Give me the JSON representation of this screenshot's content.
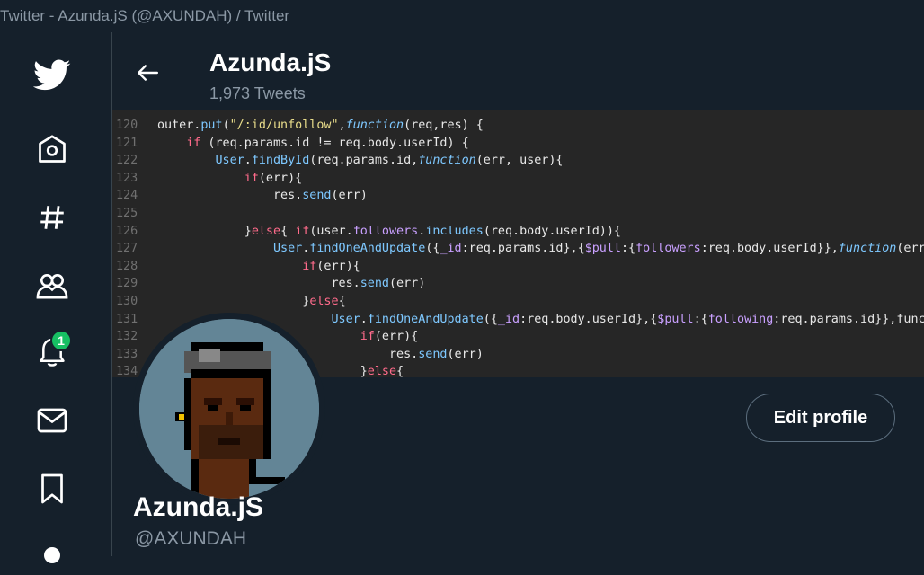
{
  "window": {
    "title": "Twitter - Azunda.jS (@AXUNDAH) / Twitter"
  },
  "sidebar": {
    "items": [
      {
        "name": "twitter-logo-icon"
      },
      {
        "name": "home-icon"
      },
      {
        "name": "explore-hashtag-icon"
      },
      {
        "name": "communities-icon"
      },
      {
        "name": "notifications-bell-icon",
        "badge": "1"
      },
      {
        "name": "messages-envelope-icon"
      },
      {
        "name": "bookmark-icon"
      },
      {
        "name": "profile-icon"
      }
    ]
  },
  "header": {
    "name": "Azunda.jS",
    "tweet_count": "1,973 Tweets"
  },
  "banner": {
    "code_lines": [
      {
        "n": "120",
        "text": "outer.put(\"/:id/unfollow\",function(req,res) {"
      },
      {
        "n": "121",
        "text": "    if (req.params.id != req.body.userId) {"
      },
      {
        "n": "122",
        "text": "        User.findById(req.params.id,function(err, user){"
      },
      {
        "n": "123",
        "text": "            if(err){"
      },
      {
        "n": "124",
        "text": "                res.send(err)"
      },
      {
        "n": "125",
        "text": ""
      },
      {
        "n": "126",
        "text": "            }else{ if(user.followers.includes(req.body.userId)){"
      },
      {
        "n": "127",
        "text": "                User.findOneAndUpdate({_id:req.params.id},{$pull:{followers:req.body.userId}},function(err,)"
      },
      {
        "n": "128",
        "text": "                    if(err){"
      },
      {
        "n": "129",
        "text": "                        res.send(err)"
      },
      {
        "n": "130",
        "text": "                    }else{"
      },
      {
        "n": "131",
        "text": "                        User.findOneAndUpdate({_id:req.body.userId},{$pull:{following:req.params.id}},functi"
      },
      {
        "n": "132",
        "text": "                            if(err){"
      },
      {
        "n": "133",
        "text": "                                res.send(err)"
      },
      {
        "n": "134",
        "text": "                            }else{"
      }
    ]
  },
  "profile": {
    "edit_button": "Edit profile",
    "name": "Azunda.jS",
    "handle": "@AXUNDAH"
  },
  "colors": {
    "background": "#15202b",
    "secondary_text": "#8b98a5",
    "badge": "#17bf63"
  }
}
